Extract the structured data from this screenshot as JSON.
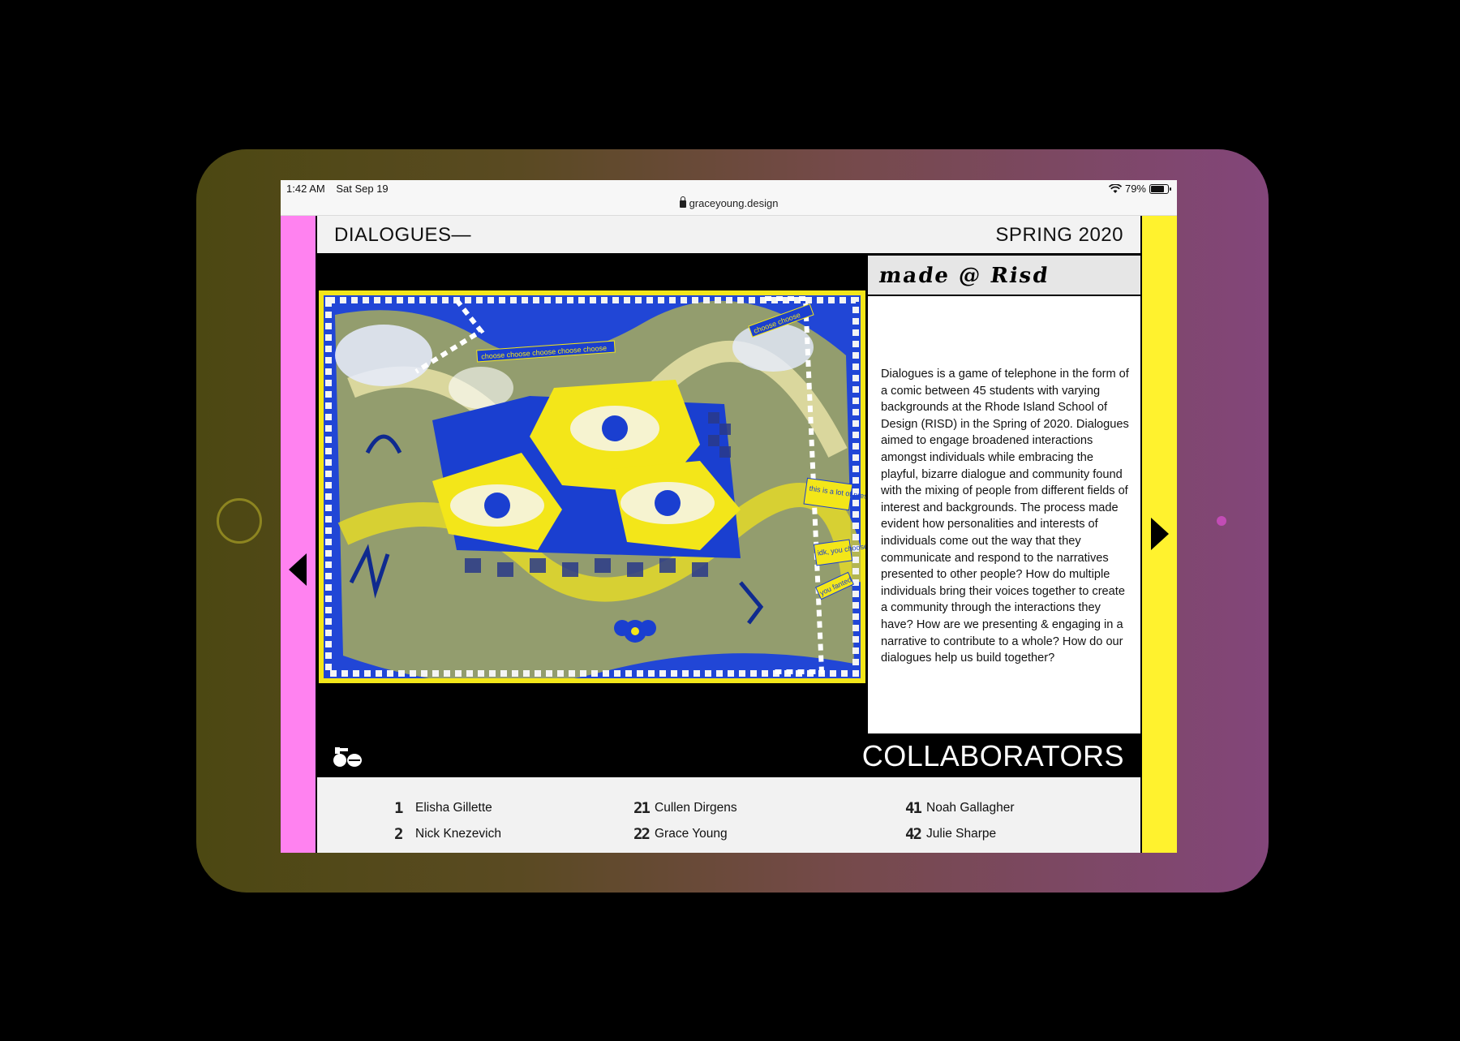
{
  "device": {
    "statusbar": {
      "time": "1:42 AM",
      "date": "Sat Sep 19",
      "battery": "79%",
      "battery_level": 0.79,
      "url": "graceyoung.design"
    }
  },
  "header": {
    "title": "DIALOGUES—",
    "season": "SPRING 2020"
  },
  "panel": {
    "logo": "made @ Risd",
    "description": "Dialogues is a game of telephone in the form of a comic between 45 students with varying backgrounds at the Rhode Island School of Design (RISD) in the Spring of 2020. Dialogues aimed to engage broadened interactions amongst individuals while embracing the playful, bizarre dialogue and community found with the mixing of people from different fields of interest and backgrounds. The process made evident how personalities and interests of individuals come out the way that they communicate and respond to the narratives presented to other people? How do multiple individuals bring their voices together to create a community through the interactions they have? How are we presenting & engaging in a narrative to contribute to a whole? How do our dialogues help us build together?"
  },
  "artwork": {
    "labels": [
      "choose choose choose choose choose",
      "choose choose",
      "this is a lot of pressure...",
      "idk, you choose",
      "you fanted"
    ]
  },
  "collaborators": {
    "title": "COLLABORATORS",
    "columns": [
      [
        {
          "num": "1",
          "name": "Elisha Gillette"
        },
        {
          "num": "2",
          "name": "Nick Knezevich"
        }
      ],
      [
        {
          "num": "21",
          "name": "Cullen Dirgens"
        },
        {
          "num": "22",
          "name": "Grace Young"
        }
      ],
      [
        {
          "num": "41",
          "name": "Noah Gallagher"
        },
        {
          "num": "42",
          "name": "Julie Sharpe"
        }
      ]
    ]
  },
  "colors": {
    "left_rail": "#ff82f0",
    "right_rail": "#fff22e",
    "art_blue": "#1a3fd0",
    "art_yellow": "#f3e619"
  },
  "icons": {
    "prev": "triangle-left-icon",
    "next": "triangle-right-icon",
    "collab": "blob-glyph-icon"
  }
}
